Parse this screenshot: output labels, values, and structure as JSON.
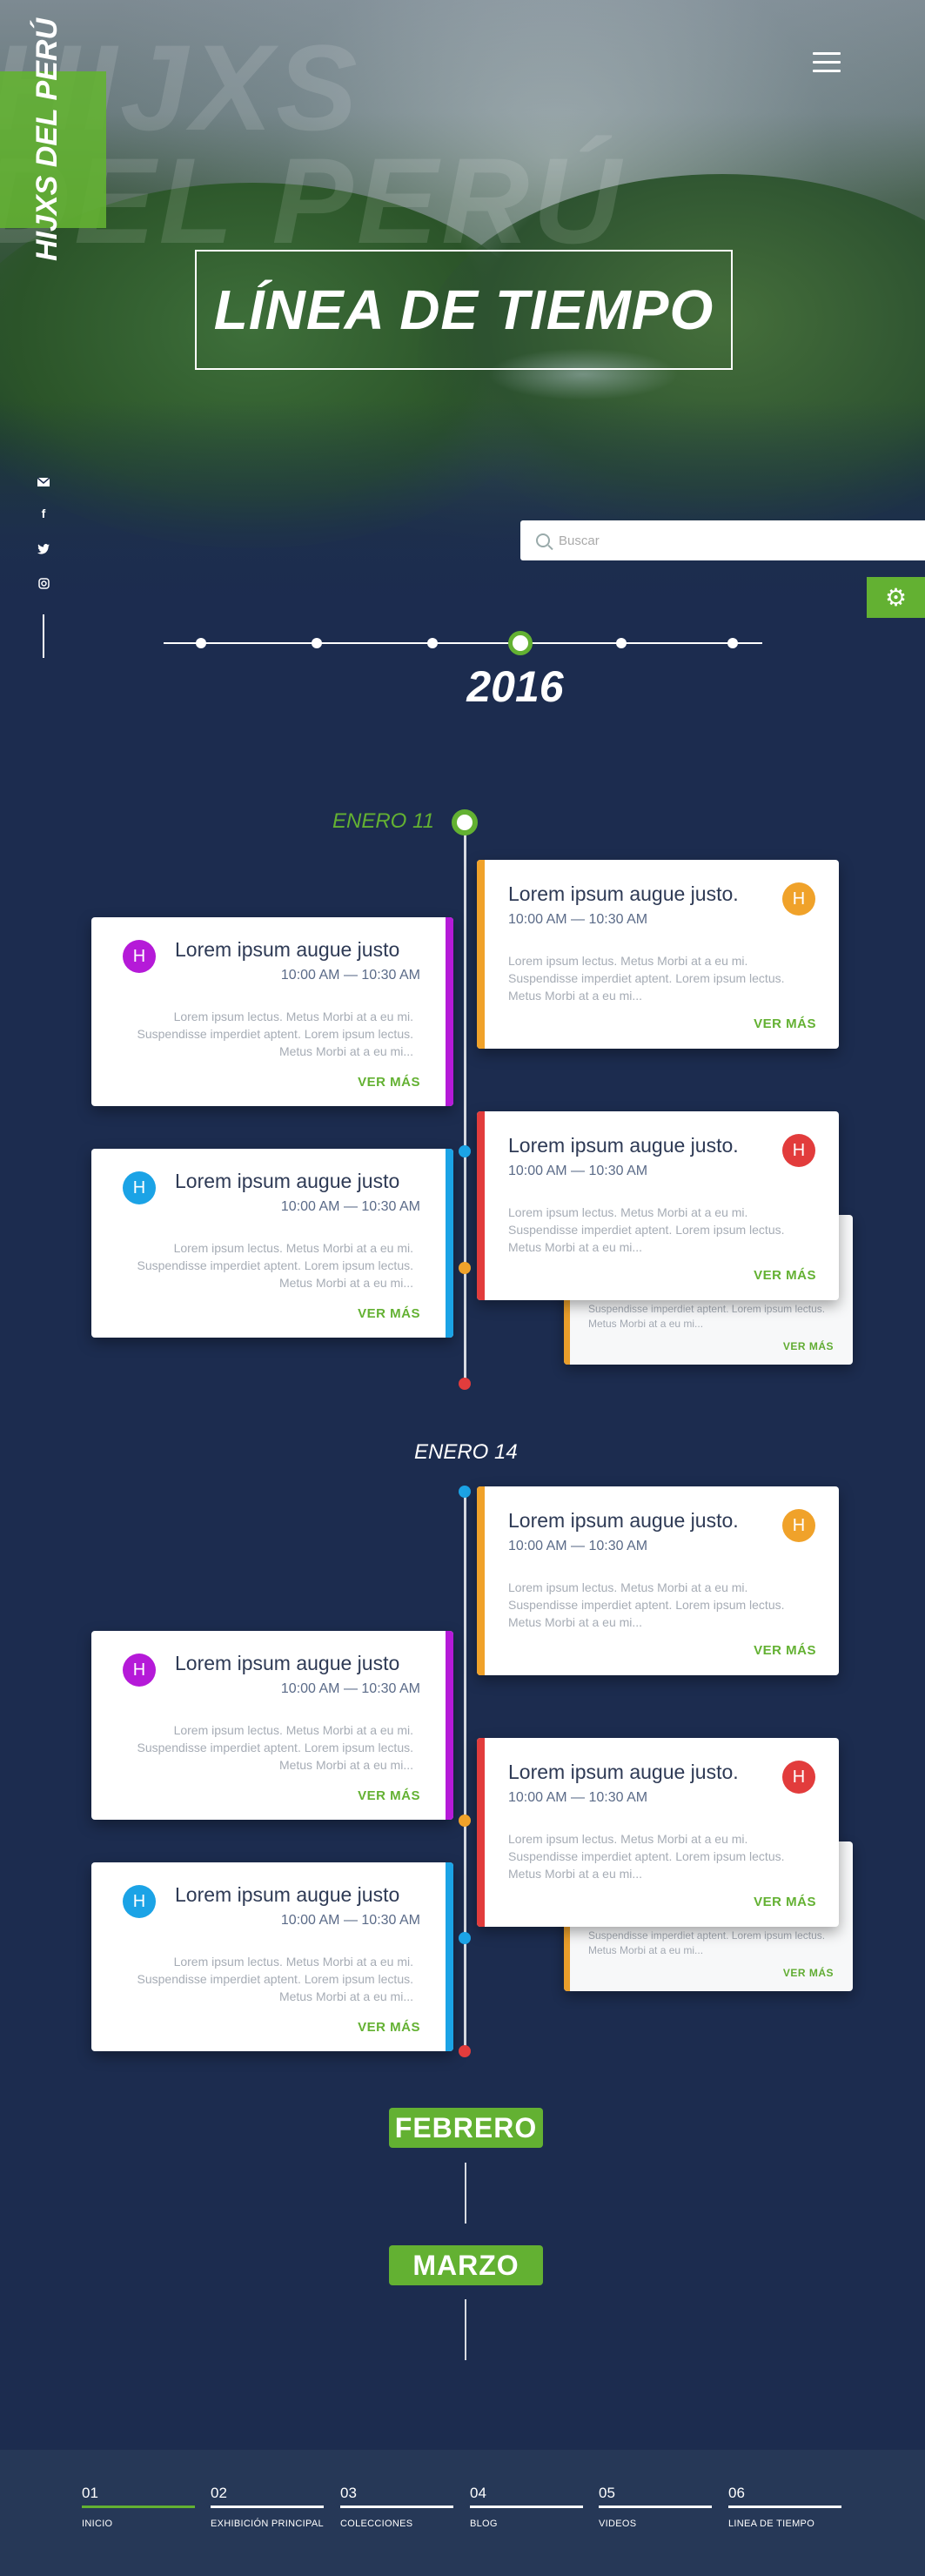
{
  "brand": {
    "name": "HIJXS DEL PERÚ",
    "ghost1": "HIJXS",
    "ghost2": "DEL PERÚ"
  },
  "hero": {
    "title": "LÍNEA DE TIEMPO"
  },
  "social": {
    "items": [
      "mail-icon",
      "facebook-icon",
      "twitter-icon",
      "instagram-icon"
    ]
  },
  "search": {
    "placeholder": "Buscar"
  },
  "timeline": {
    "year": "2016",
    "years_count_shown": 6
  },
  "months": {
    "enero11": "ENERO 11",
    "enero14": "ENERO 14",
    "febrero": "FEBRERO",
    "marzo": "MARZO"
  },
  "card": {
    "title_right": "Lorem ipsum augue justo.",
    "title_left": "Lorem ipsum augue justo",
    "time": "10:00 AM — 10:30 AM",
    "body": "Lorem ipsum lectus. Metus Morbi at a eu mi. Suspendisse imperdiet aptent. Lorem ipsum lectus. Metus Morbi at a eu mi...",
    "body_short": "Suspendisse imperdiet aptent. Lorem ipsum lectus. Metus Morbi at a eu mi...",
    "more": "VER MÁS",
    "avatar": "H"
  },
  "colors": {
    "green": "#63b132",
    "purple": "#b51ad8",
    "blue": "#1ba3e6",
    "orange": "#f0a22a",
    "red": "#e23c3c",
    "navy": "#1c2c4f"
  },
  "footer": {
    "items": [
      {
        "num": "01",
        "label": "INICIO"
      },
      {
        "num": "02",
        "label": "EXHIBICIÓN PRINCIPAL"
      },
      {
        "num": "03",
        "label": "COLECCIONES"
      },
      {
        "num": "04",
        "label": "BLOG"
      },
      {
        "num": "05",
        "label": "VIDEOS"
      },
      {
        "num": "06",
        "label": "LINEA DE TIEMPO"
      }
    ]
  }
}
